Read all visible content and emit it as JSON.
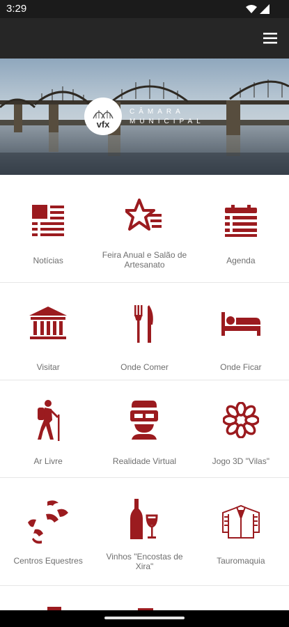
{
  "status": {
    "time": "3:29"
  },
  "brand": {
    "logo_text": "vfx",
    "line1": "CÂMARA",
    "line2": "MUNICIPAL"
  },
  "theme": {
    "accent": "#9b1b1f",
    "appbar": "#262626",
    "label": "#6e6e6e"
  },
  "tiles": [
    {
      "label": "Notícias",
      "icon": "newspaper-icon"
    },
    {
      "label": "Feira Anual e Salão de Artesanato",
      "icon": "star-list-icon"
    },
    {
      "label": "Agenda",
      "icon": "calendar-icon"
    },
    {
      "label": "Visitar",
      "icon": "building-icon"
    },
    {
      "label": "Onde Comer",
      "icon": "fork-knife-icon"
    },
    {
      "label": "Onde Ficar",
      "icon": "bed-icon"
    },
    {
      "label": "Ar Livre",
      "icon": "hiker-icon"
    },
    {
      "label": "Realidade Virtual",
      "icon": "vr-headset-icon"
    },
    {
      "label": "Jogo 3D \"Vilas\"",
      "icon": "flower-icon"
    },
    {
      "label": "Centros Equestres",
      "icon": "horse-icon"
    },
    {
      "label": "Vinhos \"Encostas de Xira\"",
      "icon": "wine-icon"
    },
    {
      "label": "Tauromaquia",
      "icon": "jacket-icon"
    }
  ]
}
